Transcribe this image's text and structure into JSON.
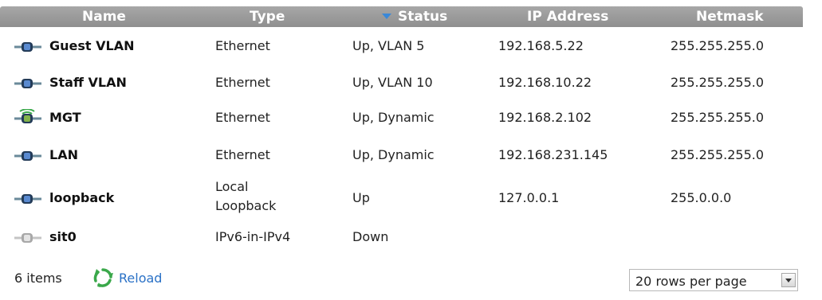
{
  "table": {
    "columns": {
      "name": "Name",
      "type": "Type",
      "status": "Status",
      "ip": "IP Address",
      "netmask": "Netmask"
    },
    "sorted_column": "status",
    "rows": [
      {
        "icon": "network-interface-icon",
        "name": "Guest VLAN",
        "type": "Ethernet",
        "type2": "",
        "status": "Up, VLAN 5",
        "ip": "192.168.5.22",
        "netmask": "255.255.255.0"
      },
      {
        "icon": "network-interface-icon",
        "name": "Staff VLAN",
        "type": "Ethernet",
        "type2": "",
        "status": "Up, VLAN 10",
        "ip": "192.168.10.22",
        "netmask": "255.255.255.0"
      },
      {
        "icon": "wireless-interface-icon",
        "name": "MGT",
        "type": "Ethernet",
        "type2": "",
        "status": "Up, Dynamic",
        "ip": "192.168.2.102",
        "netmask": "255.255.255.0"
      },
      {
        "icon": "network-interface-icon",
        "name": "LAN",
        "type": "Ethernet",
        "type2": "",
        "status": "Up, Dynamic",
        "ip": "192.168.231.145",
        "netmask": "255.255.255.0"
      },
      {
        "icon": "network-interface-icon",
        "name": "loopback",
        "type": "Local",
        "type2": "Loopback",
        "status": "Up",
        "ip": "127.0.0.1",
        "netmask": "255.0.0.0"
      },
      {
        "icon": "disabled-interface-icon",
        "name": "sit0",
        "type": "IPv6-in-IPv4",
        "type2": "",
        "status": "Down",
        "ip": "",
        "netmask": ""
      }
    ]
  },
  "footer": {
    "items_count": "6 items",
    "reload_label": "Reload",
    "rows_per_page": "20 rows per page"
  },
  "colors": {
    "header": "#999999",
    "sort_arrow": "#3a88d8",
    "link": "#2a71c6",
    "reload_icon": "#3aa84a"
  }
}
